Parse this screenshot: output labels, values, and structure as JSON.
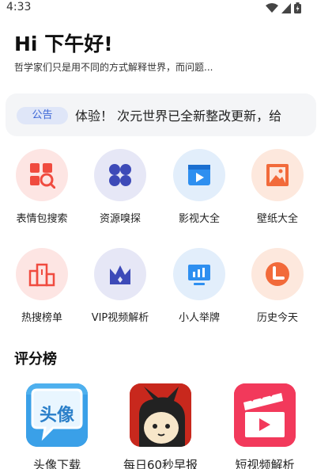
{
  "status_bar": {
    "time": "4:33"
  },
  "header": {
    "greeting": "Hi 下午好!",
    "quote": "哲学家们只是用不同的方式解释世界，而问题..."
  },
  "notice": {
    "badge": "公告",
    "text": "体验！  次元世界已全新整改更新，给"
  },
  "features": [
    {
      "label": "表情包搜索",
      "icon": "emoji-search-icon"
    },
    {
      "label": "资源嗅探",
      "icon": "clover-icon"
    },
    {
      "label": "影视大全",
      "icon": "video-icon"
    },
    {
      "label": "壁纸大全",
      "icon": "image-icon"
    },
    {
      "label": "热搜榜单",
      "icon": "ranking-icon"
    },
    {
      "label": "VIP视频解析",
      "icon": "crown-icon"
    },
    {
      "label": "小人举牌",
      "icon": "sign-board-icon"
    },
    {
      "label": "历史今天",
      "icon": "clock-icon"
    }
  ],
  "ratings": {
    "title": "评分榜",
    "apps": [
      {
        "label": "头像下载",
        "tile_text": "头像"
      },
      {
        "label": "每日60秒早报"
      },
      {
        "label": "短视频解析"
      }
    ]
  },
  "colors": {
    "accent_red": "#f04b3f",
    "accent_purple": "#3d4ab8",
    "accent_blue": "#2e8ff0",
    "accent_orange": "#f26a3a",
    "badge_blue": "#3b66d6"
  }
}
